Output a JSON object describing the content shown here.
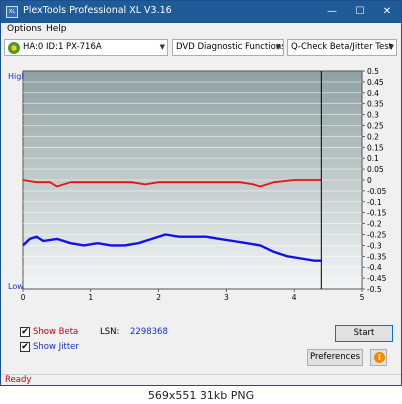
{
  "window": {
    "title": "PlexTools Professional XL V3.16",
    "icon_label": "XL",
    "controls": {
      "minimize": "—",
      "maximize": "☐",
      "close": "✕"
    }
  },
  "menu": {
    "options": "Options",
    "help": "Help"
  },
  "toolbar": {
    "drive": "HA:0 ID:1  PX-716A",
    "function": "DVD Diagnostic Functions",
    "test": "Q-Check Beta/Jitter Test"
  },
  "chart": {
    "y_left_high": "High",
    "y_left_low": "Low",
    "x_ticks": [
      "0",
      "1",
      "2",
      "3",
      "4",
      "5"
    ],
    "y_right_ticks": [
      "0.5",
      "0.45",
      "0.4",
      "0.35",
      "0.3",
      "0.25",
      "0.2",
      "0.15",
      "0.1",
      "0.05",
      "0",
      "-0.05",
      "-0.1",
      "-0.15",
      "-0.2",
      "-0.25",
      "-0.3",
      "-0.35",
      "-0.4",
      "-0.45",
      "-0.5"
    ],
    "colors": {
      "beta": "#ee1111",
      "jitter": "#1111ee",
      "bg_top": "#8fa1a1",
      "bg_bottom": "#f4f6f6",
      "marker": "#000000"
    }
  },
  "chart_data": {
    "type": "line",
    "x_range": [
      0,
      5
    ],
    "y_range": [
      -0.5,
      0.5
    ],
    "marker_x": 4.4,
    "series": [
      {
        "name": "Beta",
        "x": [
          0,
          0.2,
          0.4,
          0.5,
          0.7,
          1.0,
          1.3,
          1.6,
          1.8,
          2.0,
          2.3,
          2.6,
          2.9,
          3.2,
          3.4,
          3.5,
          3.7,
          4.0,
          4.2,
          4.4
        ],
        "y": [
          0.0,
          -0.01,
          -0.01,
          -0.03,
          -0.01,
          -0.01,
          -0.01,
          -0.01,
          -0.02,
          -0.01,
          -0.01,
          -0.01,
          -0.01,
          -0.01,
          -0.02,
          -0.03,
          -0.01,
          0.0,
          0.0,
          0.0
        ]
      },
      {
        "name": "Jitter",
        "x": [
          0,
          0.1,
          0.2,
          0.3,
          0.5,
          0.7,
          0.9,
          1.1,
          1.3,
          1.5,
          1.7,
          1.9,
          2.1,
          2.3,
          2.5,
          2.7,
          2.9,
          3.1,
          3.3,
          3.5,
          3.7,
          3.9,
          4.1,
          4.3,
          4.4
        ],
        "y": [
          -0.3,
          -0.27,
          -0.26,
          -0.28,
          -0.27,
          -0.29,
          -0.3,
          -0.29,
          -0.3,
          -0.3,
          -0.29,
          -0.27,
          -0.25,
          -0.26,
          -0.26,
          -0.26,
          -0.27,
          -0.28,
          -0.29,
          -0.3,
          -0.33,
          -0.35,
          -0.36,
          -0.37,
          -0.37
        ]
      }
    ]
  },
  "bottom": {
    "show_beta": "Show Beta",
    "show_jitter": "Show Jitter",
    "show_beta_checked": true,
    "show_jitter_checked": true,
    "check_mark": "✔",
    "lsn_label": "LSN:",
    "lsn_value": "2298368",
    "start": "Start",
    "preferences": "Preferences",
    "info_glyph": "i"
  },
  "status": {
    "text": "Ready"
  },
  "caption": "569x551  31kb  PNG"
}
